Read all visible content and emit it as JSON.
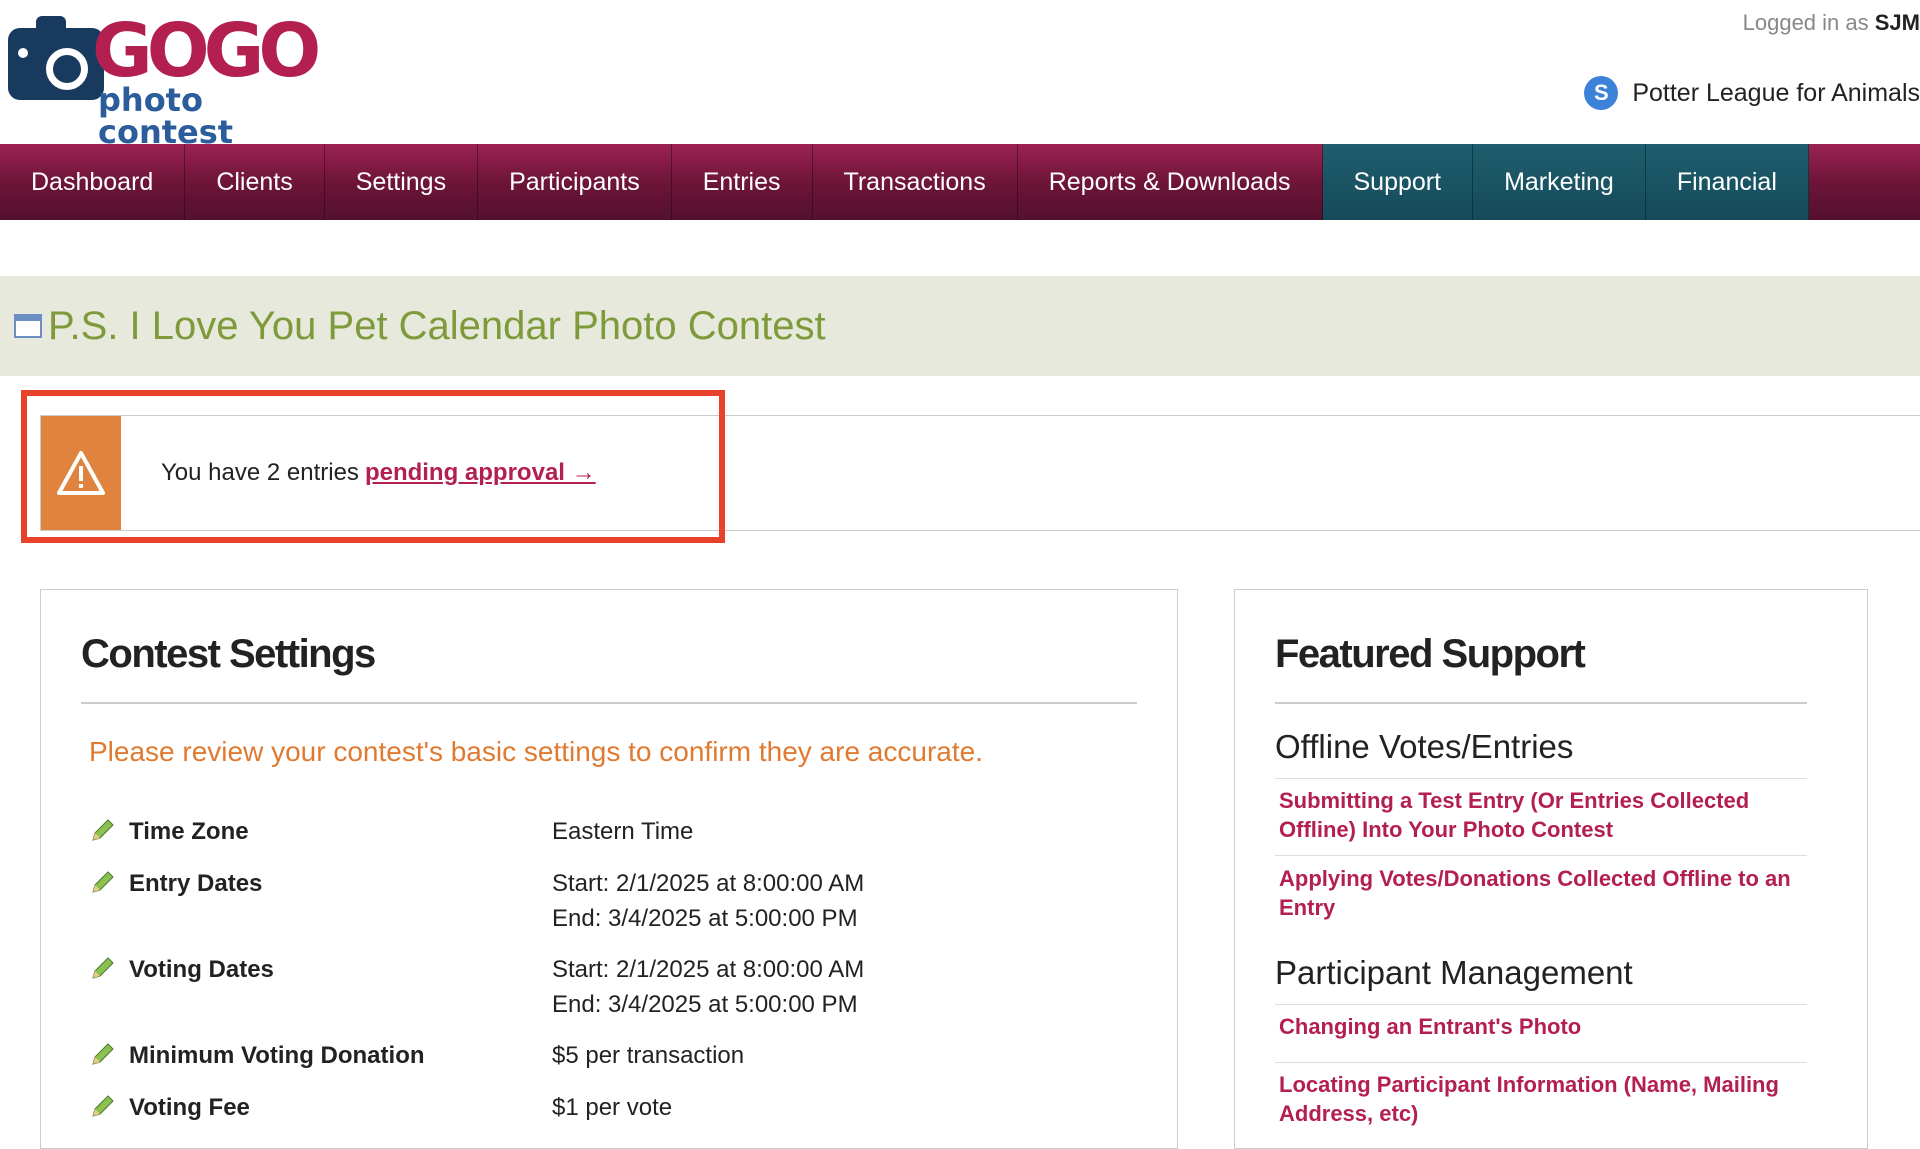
{
  "header": {
    "logo_word": "GOGO",
    "logo_sub": "photo contest",
    "logged_in_prefix": "Logged in as",
    "logged_in_user": "SJM",
    "client_name": "Potter League for Animals"
  },
  "nav": {
    "items": [
      {
        "label": "Dashboard"
      },
      {
        "label": "Clients"
      },
      {
        "label": "Settings"
      },
      {
        "label": "Participants"
      },
      {
        "label": "Entries"
      },
      {
        "label": "Transactions"
      },
      {
        "label": "Reports & Downloads"
      },
      {
        "label": "Support"
      },
      {
        "label": "Marketing"
      },
      {
        "label": "Financial"
      }
    ]
  },
  "page": {
    "title": "P.S. I Love You Pet Calendar Photo Contest"
  },
  "alert": {
    "text": "You have 2 entries",
    "link": "pending approval →"
  },
  "contest_settings": {
    "heading": "Contest Settings",
    "intro": "Please review your contest's basic settings to confirm they are accurate.",
    "rows": [
      {
        "label": "Time Zone",
        "value": "Eastern Time",
        "value2": ""
      },
      {
        "label": "Entry Dates",
        "value": "Start: 2/1/2025 at 8:00:00 AM",
        "value2": "End: 3/4/2025 at 5:00:00 PM"
      },
      {
        "label": "Voting Dates",
        "value": "Start: 2/1/2025 at 8:00:00 AM",
        "value2": "End: 3/4/2025 at 5:00:00 PM"
      },
      {
        "label": "Minimum Voting Donation",
        "value": "$5 per transaction",
        "value2": ""
      },
      {
        "label": "Voting Fee",
        "value": "$1 per vote",
        "value2": ""
      }
    ]
  },
  "featured_support": {
    "heading": "Featured Support",
    "sections": [
      {
        "title": "Offline Votes/Entries",
        "links": [
          "Submitting a Test Entry (Or Entries Collected Offline) Into Your Photo Contest",
          "Applying Votes/Donations Collected Offline to an Entry"
        ]
      },
      {
        "title": "Participant Management",
        "links": [
          "Changing an Entrant's Photo",
          "Locating Participant Information (Name, Mailing Address, etc)"
        ]
      }
    ]
  },
  "colors": {
    "nav_maroon": "#8a1c48",
    "nav_teal": "#1a5565",
    "title_green": "#7f9a3a",
    "alert_orange": "#e0833e",
    "highlight_red": "#e8422b",
    "link_maroon": "#b31f4f",
    "intro_orange": "#e07a30"
  }
}
